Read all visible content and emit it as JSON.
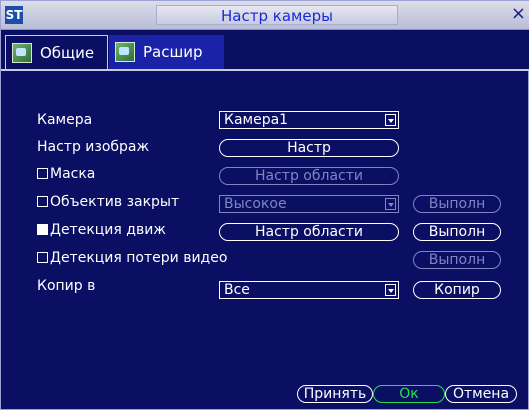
{
  "window": {
    "logo": "ST",
    "title": "Настр камеры",
    "close_label": "×"
  },
  "tabs": [
    {
      "label": "Общие"
    },
    {
      "label": "Расшир"
    }
  ],
  "form": {
    "camera_label": "Камера",
    "camera_value": "Камера1",
    "image_settings_label": "Настр изображ",
    "image_settings_button": "Настр",
    "mask_label": "Маска",
    "mask_checked": false,
    "mask_area_button": "Настр области",
    "lens_closed_label": "Объектив закрыт",
    "lens_closed_checked": false,
    "lens_sensitivity_value": "Высокое",
    "lens_action_button": "Выполн",
    "motion_label": "Детекция движ",
    "motion_checked": true,
    "motion_area_button": "Настр области",
    "motion_action_button": "Выполн",
    "video_loss_label": "Детекция потери видео",
    "video_loss_checked": false,
    "video_loss_action_button": "Выполн",
    "copy_to_label": "Копир в",
    "copy_to_value": "Все",
    "copy_button": "Копир"
  },
  "footer": {
    "apply_button": "Принять",
    "ok_button": "Ок",
    "cancel_button": "Отмена"
  }
}
